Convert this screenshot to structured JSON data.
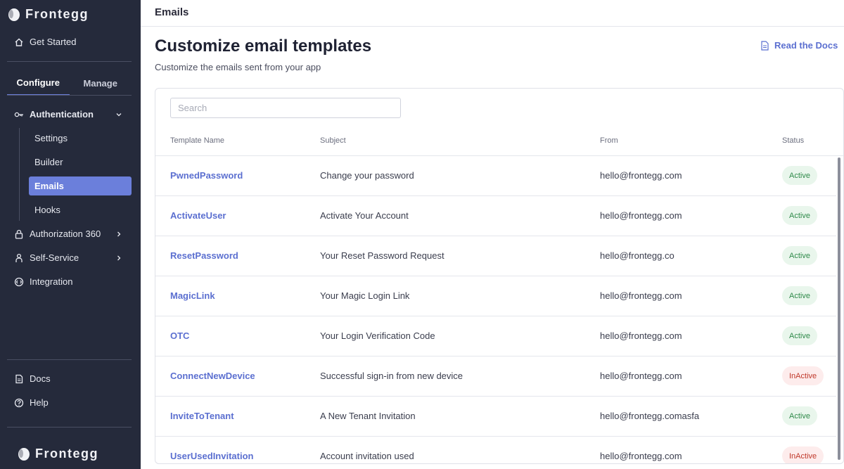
{
  "sidebar": {
    "brand": "Frontegg",
    "get_started": "Get Started",
    "tabs": [
      {
        "label": "Configure",
        "active": true
      },
      {
        "label": "Manage",
        "active": false
      }
    ],
    "authentication": {
      "label": "Authentication",
      "children": [
        {
          "label": "Settings",
          "active": false
        },
        {
          "label": "Builder",
          "active": false
        },
        {
          "label": "Emails",
          "active": true
        },
        {
          "label": "Hooks",
          "active": false
        }
      ]
    },
    "authorization": "Authorization 360",
    "self_service": "Self-Service",
    "integration": "Integration",
    "docs": "Docs",
    "help": "Help",
    "footer_brand": "Frontegg"
  },
  "topbar": {
    "title": "Emails"
  },
  "page": {
    "title": "Customize email templates",
    "subtitle": "Customize the emails sent from your app",
    "docs_link": "Read the Docs"
  },
  "search": {
    "placeholder": "Search",
    "value": ""
  },
  "table": {
    "headers": {
      "name": "Template Name",
      "subject": "Subject",
      "from": "From",
      "status": "Status"
    },
    "rows": [
      {
        "name": "PwnedPassword",
        "subject": "Change your password",
        "from": "hello@frontegg.com",
        "status": "Active"
      },
      {
        "name": "ActivateUser",
        "subject": "Activate Your Account",
        "from": "hello@frontegg.com",
        "status": "Active"
      },
      {
        "name": "ResetPassword",
        "subject": "Your Reset Password Request",
        "from": "hello@frontegg.co",
        "status": "Active"
      },
      {
        "name": "MagicLink",
        "subject": "Your Magic Login Link",
        "from": "hello@frontegg.com",
        "status": "Active"
      },
      {
        "name": "OTC",
        "subject": "Your Login Verification Code",
        "from": "hello@frontegg.com",
        "status": "Active"
      },
      {
        "name": "ConnectNewDevice",
        "subject": "Successful sign-in from new device",
        "from": "hello@frontegg.com",
        "status": "InActive"
      },
      {
        "name": "InviteToTenant",
        "subject": "A New Tenant Invitation",
        "from": "hello@frontegg.comasfa",
        "status": "Active"
      },
      {
        "name": "UserUsedInvitation",
        "subject": "Account invitation used",
        "from": "hello@frontegg.com",
        "status": "InActive"
      }
    ]
  },
  "colors": {
    "sidebar_bg": "#252a3b",
    "accent": "#6b7fdb",
    "link": "#5b6fd0",
    "active_badge": "#2f8a4a",
    "inactive_badge": "#c0392b"
  }
}
